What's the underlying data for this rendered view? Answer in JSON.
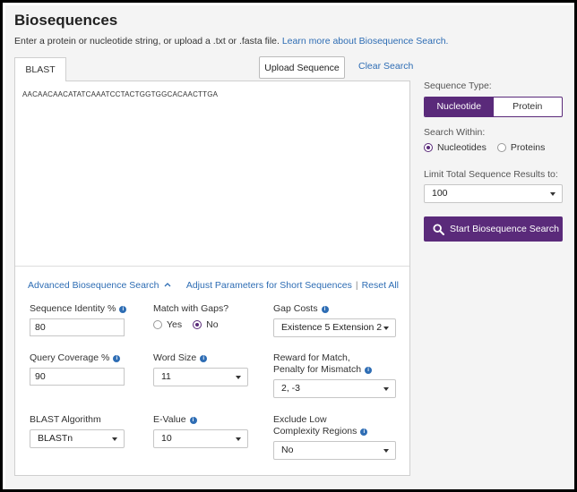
{
  "header": {
    "title": "Biosequences",
    "subtitle_text": "Enter a protein or nucleotide string, or upload a .txt or .fasta file.",
    "learn_more_link": "Learn more about Biosequence Search."
  },
  "editor": {
    "tab_label": "BLAST",
    "upload_button": "Upload Sequence",
    "clear_link": "Clear Search",
    "sequence": "AACAACAACATATCAAATCCTACTGGTGGCACAACTTGA"
  },
  "advanced": {
    "toggle_label": "Advanced Biosequence Search",
    "adjust_link": "Adjust Parameters for Short Sequences",
    "separator": "|",
    "reset_link": "Reset All",
    "sequence_identity": {
      "label": "Sequence Identity %",
      "value": "80"
    },
    "match_with_gaps": {
      "label": "Match with Gaps?",
      "options": [
        "Yes",
        "No"
      ],
      "selected": "No"
    },
    "gap_costs": {
      "label": "Gap Costs",
      "value": "Existence 5 Extension 2"
    },
    "query_coverage": {
      "label": "Query Coverage %",
      "value": "90"
    },
    "word_size": {
      "label": "Word Size",
      "value": "11"
    },
    "reward_penalty": {
      "label_line1": "Reward for Match,",
      "label_line2": "Penalty for Mismatch",
      "value": "2, -3"
    },
    "blast_algorithm": {
      "label": "BLAST Algorithm",
      "value": "BLASTn"
    },
    "e_value": {
      "label": "E-Value",
      "value": "10"
    },
    "exclude_low": {
      "label_line1": "Exclude Low",
      "label_line2": "Complexity Regions",
      "value": "No"
    }
  },
  "sidebar": {
    "sequence_type_label": "Sequence Type:",
    "sequence_types": [
      "Nucleotide",
      "Protein"
    ],
    "selected_type": "Nucleotide",
    "search_within_label": "Search Within:",
    "search_within_options": [
      "Nucleotides",
      "Proteins"
    ],
    "selected_within": "Nucleotides",
    "limit_label": "Limit Total Sequence Results to:",
    "limit_value": "100",
    "start_button": "Start Biosequence Search"
  },
  "colors": {
    "accent": "#5a2a7a",
    "link": "#2e6db4"
  },
  "icons": {
    "info": "info-icon",
    "search": "search-icon",
    "caret": "chevron-down-icon"
  }
}
